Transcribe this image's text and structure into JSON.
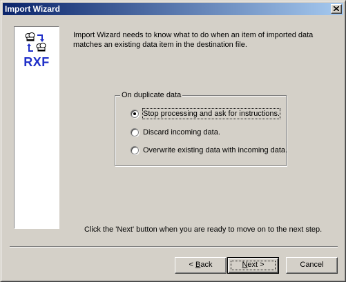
{
  "window": {
    "title": "Import Wizard"
  },
  "logo": {
    "text": "RXF",
    "icon": "chef-hats-sync-icon"
  },
  "intro": {
    "text": "Import Wizard needs to know what to do when an item of imported data matches an existing data item in the destination file."
  },
  "duplicate_group": {
    "legend": "On duplicate data",
    "options": [
      {
        "label": "Stop processing and ask for instructions.",
        "checked": true
      },
      {
        "label": "Discard incoming data.",
        "checked": false
      },
      {
        "label": "Overwrite existing data with incoming data.",
        "checked": false
      }
    ]
  },
  "footer": {
    "instruction": "Click the 'Next' button when you are ready to move on to the next step."
  },
  "buttons": {
    "back_prefix": "< ",
    "back_mnemonic": "B",
    "back_rest": "ack",
    "next_mnemonic": "N",
    "next_rest": "ext >",
    "cancel": "Cancel"
  },
  "colors": {
    "titlebar_start": "#0a246a",
    "titlebar_end": "#a6caf0",
    "logo_blue": "#1f2fc8",
    "face": "#d4d0c8"
  }
}
